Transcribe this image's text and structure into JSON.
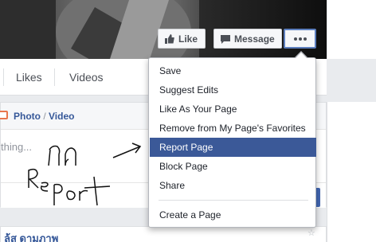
{
  "cover_buttons": {
    "like_label": "Like",
    "message_label": "Message",
    "more_icon": "ellipsis-icon"
  },
  "tabs": {
    "likes": "Likes",
    "videos": "Videos"
  },
  "composer": {
    "photo_video_prefix": "Photo",
    "photo_video_sep": " / ",
    "photo_video_suffix": "Video",
    "input_placeholder": "thing..."
  },
  "lower_section": {
    "title": "ล้ส ดามภาพ"
  },
  "menu": {
    "items": [
      {
        "label": "Save"
      },
      {
        "label": "Suggest Edits"
      },
      {
        "label": "Like As Your Page"
      },
      {
        "label": "Remove from My Page's Favorites"
      },
      {
        "label": "Report Page",
        "selected": true
      },
      {
        "label": "Block Page"
      },
      {
        "label": "Share"
      },
      {
        "label": "Create a Page"
      }
    ]
  },
  "annotation": {
    "thai_word": "กด",
    "english_word": "Report",
    "colors": {
      "ink": "#111111",
      "highlight": "#3b5998"
    }
  }
}
